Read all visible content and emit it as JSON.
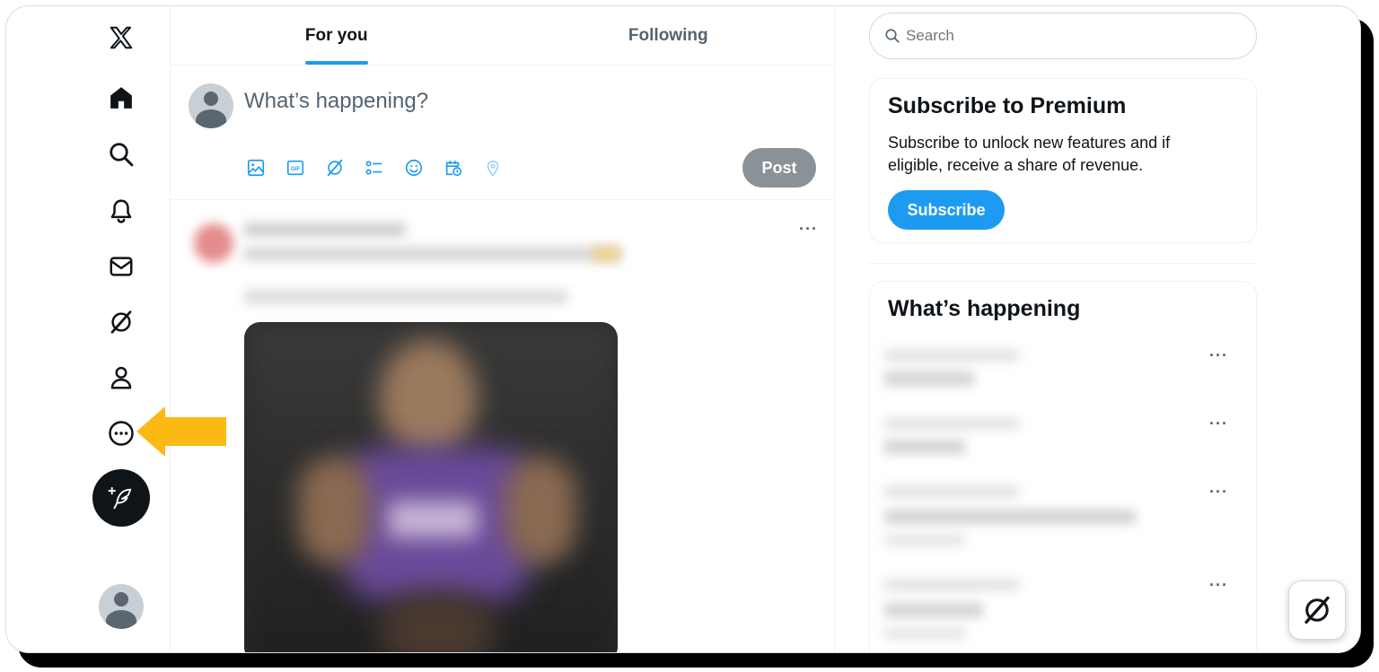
{
  "nav": {
    "items": [
      {
        "name": "x-logo-icon"
      },
      {
        "name": "home-icon"
      },
      {
        "name": "search-icon"
      },
      {
        "name": "notifications-icon"
      },
      {
        "name": "messages-icon"
      },
      {
        "name": "grok-icon"
      },
      {
        "name": "profile-icon"
      },
      {
        "name": "more-icon"
      }
    ],
    "compose_icon": "compose-post-icon",
    "arrow_color": "#fdb913"
  },
  "tabs": [
    {
      "label": "For you",
      "active": true
    },
    {
      "label": "Following",
      "active": false
    }
  ],
  "composer": {
    "placeholder": "What’s happening?",
    "tools": [
      "image-icon",
      "gif-icon",
      "grok-icon",
      "poll-icon",
      "emoji-icon",
      "schedule-icon",
      "location-icon"
    ],
    "post_label": "Post"
  },
  "feed": {
    "more_label": "···"
  },
  "search": {
    "placeholder": "Search"
  },
  "premium": {
    "title": "Subscribe to Premium",
    "text": "Subscribe to unlock new features and if eligible, receive a share of revenue.",
    "button": "Subscribe"
  },
  "trends": {
    "title": "What’s happening",
    "more_label": "···"
  },
  "colors": {
    "accent": "#1d9bf0",
    "text": "#0f1419",
    "muted": "#536471",
    "post_disabled": "#8b9297"
  }
}
